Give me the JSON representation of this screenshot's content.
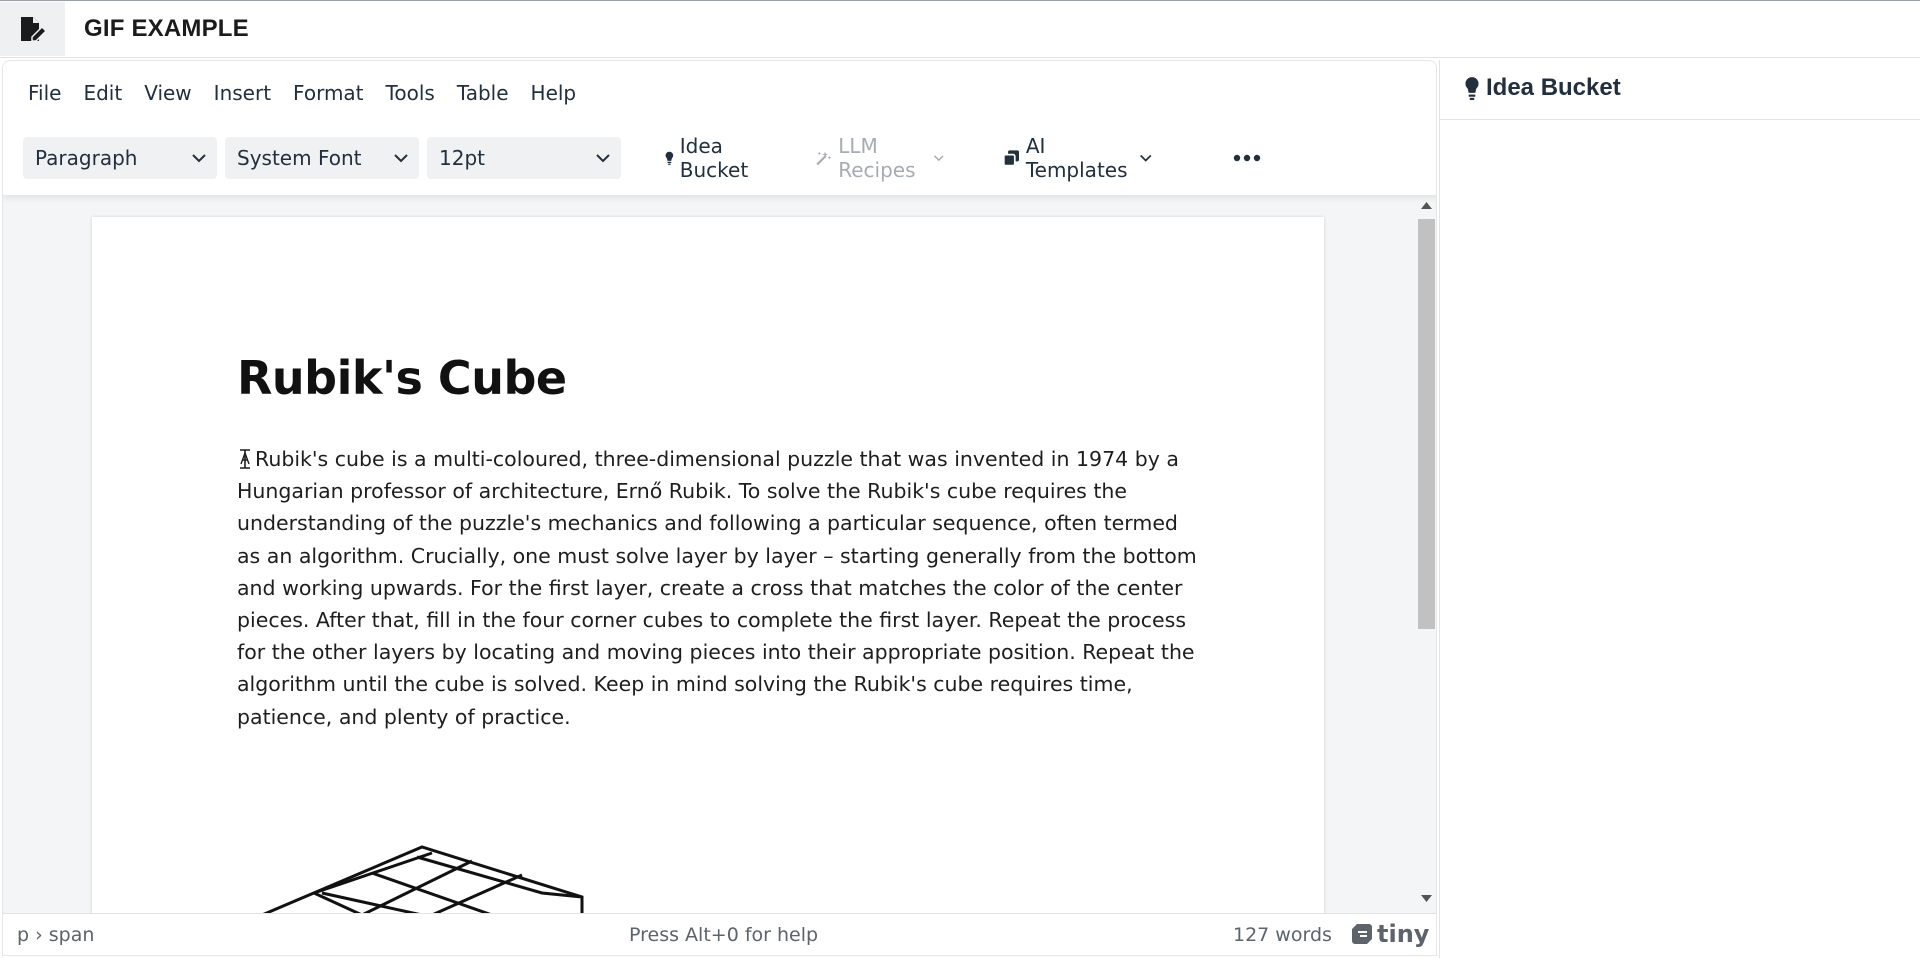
{
  "app": {
    "title": "GIF EXAMPLE",
    "icon": "file-edit-icon"
  },
  "menubar": {
    "items": [
      "File",
      "Edit",
      "View",
      "Insert",
      "Format",
      "Tools",
      "Table",
      "Help"
    ]
  },
  "toolbar": {
    "block_format": "Paragraph",
    "font_family": "System Font",
    "font_size": "12pt",
    "idea_bucket": "Idea Bucket",
    "llm_recipes": "LLM Recipes",
    "ai_templates": "AI Templates",
    "more_icon": "more-horizontal-icon"
  },
  "document": {
    "title": "Rubik's Cube",
    "body": "Rubik's cube is a multi-coloured, three-dimensional puzzle that was invented in 1974 by a Hungarian professor of architecture, Ernő Rubik. To solve the Rubik's cube requires the understanding of the puzzle's mechanics and following a particular sequence, often termed as an algorithm. Crucially, one must solve layer by layer – starting generally from the bottom and working upwards. For the first layer, create a cross that matches the color of the center pieces. After that, fill in the four corner cubes to complete the first layer. Repeat the process for the other layers by locating and moving pieces into their appropriate position. Repeat the algorithm until the cube is solved. Keep in mind solving the Rubik's cube requires time, patience, and plenty of practice."
  },
  "statusbar": {
    "path": "p › span",
    "help": "Press Alt+0 for help",
    "word_count": "127 words",
    "brand": "tiny"
  },
  "sidepanel": {
    "title": "Idea Bucket"
  },
  "colors": {
    "accent": "#222f3e",
    "disabled": "#a6acb3",
    "content_bg": "#f4f5f6"
  }
}
